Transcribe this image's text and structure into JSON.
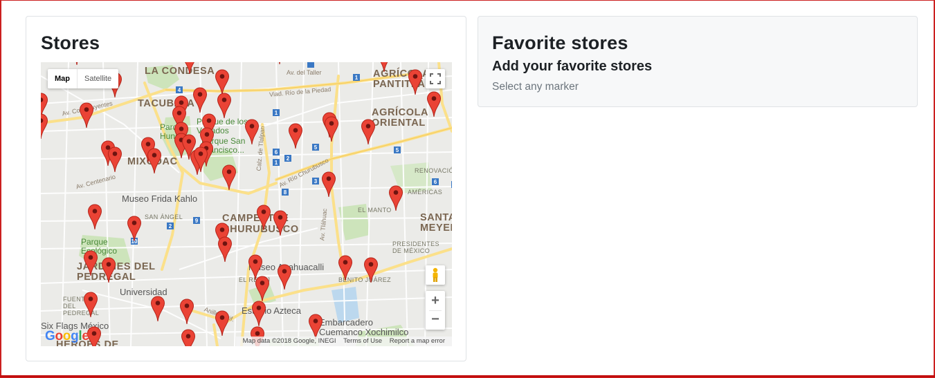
{
  "stores": {
    "title": "Stores",
    "map": {
      "type_controls": {
        "map_label": "Map",
        "satellite_label": "Satellite",
        "selected": "Map"
      },
      "zoom_in_label": "+",
      "zoom_out_label": "−",
      "attribution": [
        "Map data ©2018 Google, INEGI",
        "Terms of Use",
        "Report a map error"
      ],
      "logo_letters": [
        "G",
        "o",
        "o",
        "g",
        "l",
        "e"
      ],
      "marker_color": "#ea4335",
      "marker_dot_color": "#6e1410",
      "labels": {
        "la_condesa": "LA CONDESA",
        "tacubaya": "TACUBAYA",
        "agricola_pantitlan": "AGRÍCOLA PANTITLÁN",
        "agricola_oriental": "AGRÍCOLA ORIENTAL",
        "parque_venados": "Parque de los Venados",
        "parque_francisco": "Parque San Francisco...",
        "mixcoac": "MIXCOAC",
        "frida": "Museo Frida Kahlo",
        "campestre": "CAMPESTRE CHURUBUSCO",
        "san_angel": "SAN ÁNGEL",
        "jardines": "JARDINES DEL PEDREGAL",
        "universidad": "Universidad",
        "estadio": "Estadio Azteca",
        "anahuacalli": "Museo Anahuacalli",
        "embarcadero": "Embarcadero Cuemanco Xochimilco",
        "six_flags": "Six Flags México",
        "heroes": "HÉROES DE",
        "el_manto": "EL MANTO",
        "santa_meyehualco": "SANTA MEYEH",
        "presidentes": "PRESIDENTES DE MÉXICO",
        "benito_juarez": "BENITO JUÁREZ",
        "renovacion": "RENOVACIÓN",
        "americas": "AMÉRICAS",
        "el_relox": "EL RELOJ",
        "fuentes": "FUENTES DEL PEDREGAL",
        "churubusco": "Av. Río Churubusco",
        "rio_piedad": "Viad. Río de la Piedad",
        "periferico": "Anillo Perif.",
        "tlalpan": "Calz. de Tlalpan",
        "tlahuac": "Av. Tláhuac",
        "centenario": "Av. Centenario",
        "constituyentes": "Av. Constituyentes",
        "parque_bombas": "Parque Ecológico",
        "parque_hundido": "Parque Hundido",
        "av_taller": "Av. del Taller"
      }
    }
  },
  "favorites": {
    "title": "Favorite stores",
    "subtitle": "Add your favorite stores",
    "hint": "Select any marker"
  }
}
